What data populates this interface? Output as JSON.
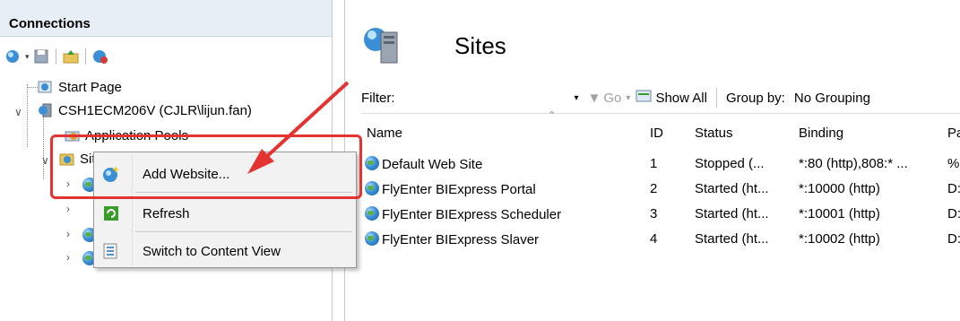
{
  "connections": {
    "title": "Connections",
    "toolbar_icons": [
      "connect-icon",
      "save-icon",
      "up-folder-icon",
      "disconnect-icon"
    ],
    "tree": {
      "start_page": "Start Page",
      "server": "CSH1ECM206V (CJLR\\lijun.fan)",
      "app_pools": "Application Pools",
      "sites": "Sites"
    }
  },
  "context_menu": {
    "items": [
      {
        "label": "Add Website...",
        "icon": "add-website-icon"
      },
      {
        "label": "Refresh",
        "icon": "refresh-icon"
      },
      {
        "label": "Switch to Content View",
        "icon": "content-view-icon"
      }
    ]
  },
  "main": {
    "title": "Sites",
    "filter": {
      "label": "Filter:",
      "value": "",
      "go_label": "Go",
      "show_all_label": "Show All",
      "group_by_label": "Group by:",
      "group_by_value": "No Grouping"
    },
    "table": {
      "columns": [
        "Name",
        "ID",
        "Status",
        "Binding",
        "Pa"
      ],
      "rows": [
        {
          "name": "Default Web Site",
          "id": "1",
          "status": "Stopped (...",
          "binding": "*:80 (http),808:* ...",
          "path": "%"
        },
        {
          "name": "FlyEnter BIExpress Portal",
          "id": "2",
          "status": "Started (ht...",
          "binding": "*:10000 (http)",
          "path": "D:"
        },
        {
          "name": "FlyEnter BIExpress Scheduler",
          "id": "3",
          "status": "Started (ht...",
          "binding": "*:10001 (http)",
          "path": "D:"
        },
        {
          "name": "FlyEnter BIExpress Slaver",
          "id": "4",
          "status": "Started (ht...",
          "binding": "*:10002 (http)",
          "path": "D:"
        }
      ]
    }
  },
  "colors": {
    "annotation_red": "#e53331",
    "header_bg": "#e8eef6"
  }
}
